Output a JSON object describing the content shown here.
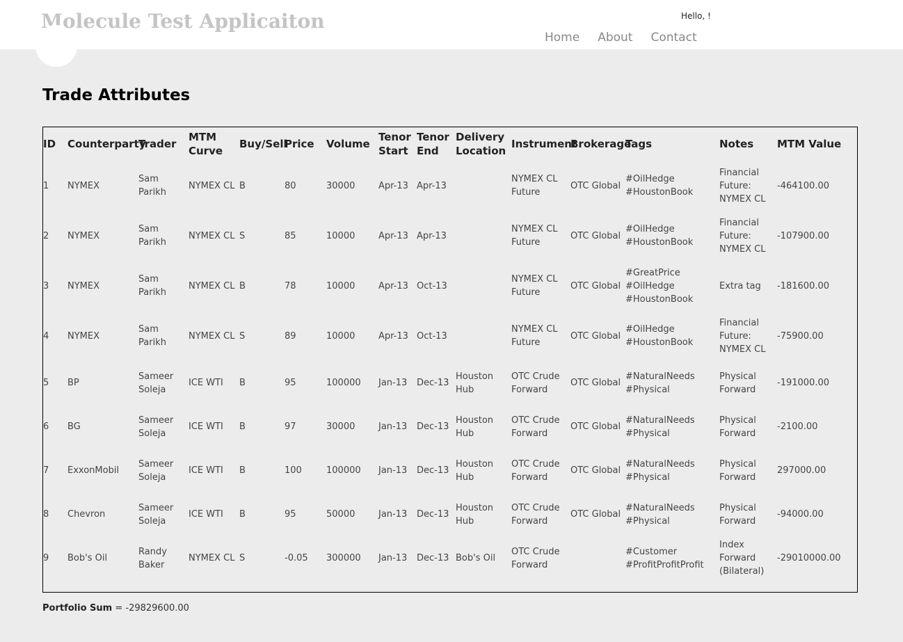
{
  "header": {
    "title": "Molecule Test Applicaiton",
    "greeting": "Hello, !",
    "nav": [
      "Home",
      "About",
      "Contact"
    ]
  },
  "page_title": "Trade Attributes",
  "table": {
    "columns": [
      "ID",
      "Counterparty",
      "Trader",
      "MTM Curve",
      "Buy/Sell",
      "Price",
      "Volume",
      "Tenor Start",
      "Tenor End",
      "Delivery Location",
      "Instrument",
      "Brokerage",
      "Tags",
      "Notes",
      "MTM Value"
    ],
    "rows": [
      [
        "1",
        "NYMEX",
        "Sam Parikh",
        "NYMEX CL",
        "B",
        "80",
        "30000",
        "Apr-13",
        "Apr-13",
        "",
        "NYMEX CL Future",
        "OTC Global",
        "#OilHedge #HoustonBook",
        "Financial Future: NYMEX CL",
        "-464100.00"
      ],
      [
        "2",
        "NYMEX",
        "Sam Parikh",
        "NYMEX CL",
        "S",
        "85",
        "10000",
        "Apr-13",
        "Apr-13",
        "",
        "NYMEX CL Future",
        "OTC Global",
        "#OilHedge #HoustonBook",
        "Financial Future: NYMEX CL",
        "-107900.00"
      ],
      [
        "3",
        "NYMEX",
        "Sam Parikh",
        "NYMEX CL",
        "B",
        "78",
        "10000",
        "Apr-13",
        "Oct-13",
        "",
        "NYMEX CL Future",
        "OTC Global",
        "#GreatPrice #OilHedge #HoustonBook",
        "Extra tag",
        "-181600.00"
      ],
      [
        "4",
        "NYMEX",
        "Sam Parikh",
        "NYMEX CL",
        "S",
        "89",
        "10000",
        "Apr-13",
        "Oct-13",
        "",
        "NYMEX CL Future",
        "OTC Global",
        "#OilHedge #HoustonBook",
        "Financial Future: NYMEX CL",
        "-75900.00"
      ],
      [
        "5",
        "BP",
        "Sameer Soleja",
        "ICE WTI",
        "B",
        "95",
        "100000",
        "Jan-13",
        "Dec-13",
        "Houston Hub",
        "OTC Crude Forward",
        "OTC Global",
        "#NaturalNeeds #Physical",
        "Physical Forward",
        "-191000.00"
      ],
      [
        "6",
        "BG",
        "Sameer Soleja",
        "ICE WTI",
        "B",
        "97",
        "30000",
        "Jan-13",
        "Dec-13",
        "Houston Hub",
        "OTC Crude Forward",
        "OTC Global",
        "#NaturalNeeds #Physical",
        "Physical Forward",
        "-2100.00"
      ],
      [
        "7",
        "ExxonMobil",
        "Sameer Soleja",
        "ICE WTI",
        "B",
        "100",
        "100000",
        "Jan-13",
        "Dec-13",
        "Houston Hub",
        "OTC Crude Forward",
        "OTC Global",
        "#NaturalNeeds #Physical",
        "Physical Forward",
        "297000.00"
      ],
      [
        "8",
        "Chevron",
        "Sameer Soleja",
        "ICE WTI",
        "B",
        "95",
        "50000",
        "Jan-13",
        "Dec-13",
        "Houston Hub",
        "OTC Crude Forward",
        "OTC Global",
        "#NaturalNeeds #Physical",
        "Physical Forward",
        "-94000.00"
      ],
      [
        "9",
        "Bob's Oil",
        "Randy Baker",
        "NYMEX CL",
        "S",
        "-0.05",
        "300000",
        "Jan-13",
        "Dec-13",
        "Bob's Oil",
        "OTC Crude Forward",
        "",
        "#Customer #ProfitProfitProfit",
        "Index Forward (Bilateral)",
        "-29010000.00"
      ]
    ]
  },
  "footer": {
    "label": "Portfolio Sum",
    "separator": " = ",
    "value": "-29829600.00"
  }
}
